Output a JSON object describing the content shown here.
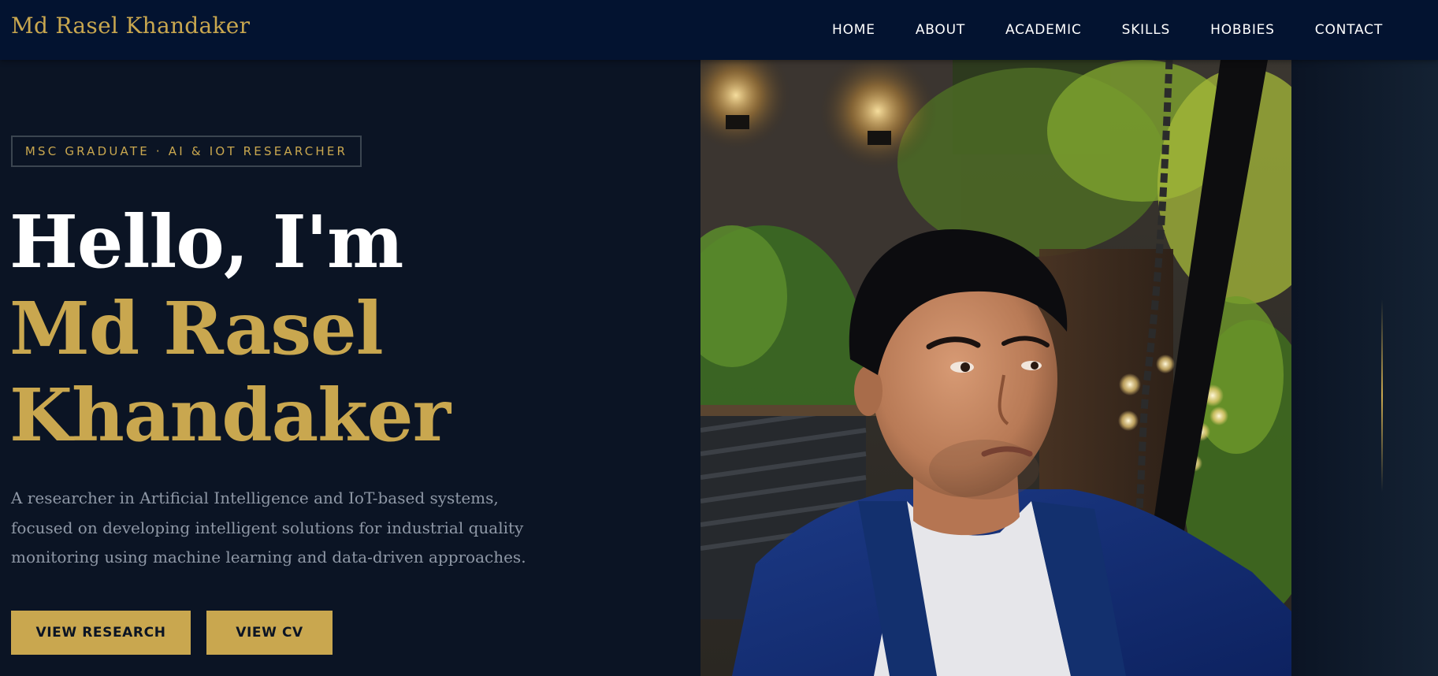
{
  "header": {
    "brand": "Md Rasel Khandaker",
    "nav": [
      "HOME",
      "ABOUT",
      "ACADEMIC",
      "SKILLS",
      "HOBBIES",
      "CONTACT"
    ]
  },
  "hero": {
    "badge": "MSC GRADUATE · AI & IOT RESEARCHER",
    "greeting": "Hello, I'm",
    "name_line1": "Md Rasel",
    "name_line2": "Khandaker",
    "intro": "A researcher in Artificial Intelligence and IoT-based systems, focused on developing intelligent solutions for industrial quality monitoring using machine learning and data-driven approaches.",
    "buttons": {
      "research": "VIEW RESEARCH",
      "cv": "VIEW CV"
    }
  },
  "colors": {
    "background": "#0b1424",
    "header": "#031330",
    "accent_gold": "#c9a74f",
    "muted_text": "#8f98a6"
  }
}
